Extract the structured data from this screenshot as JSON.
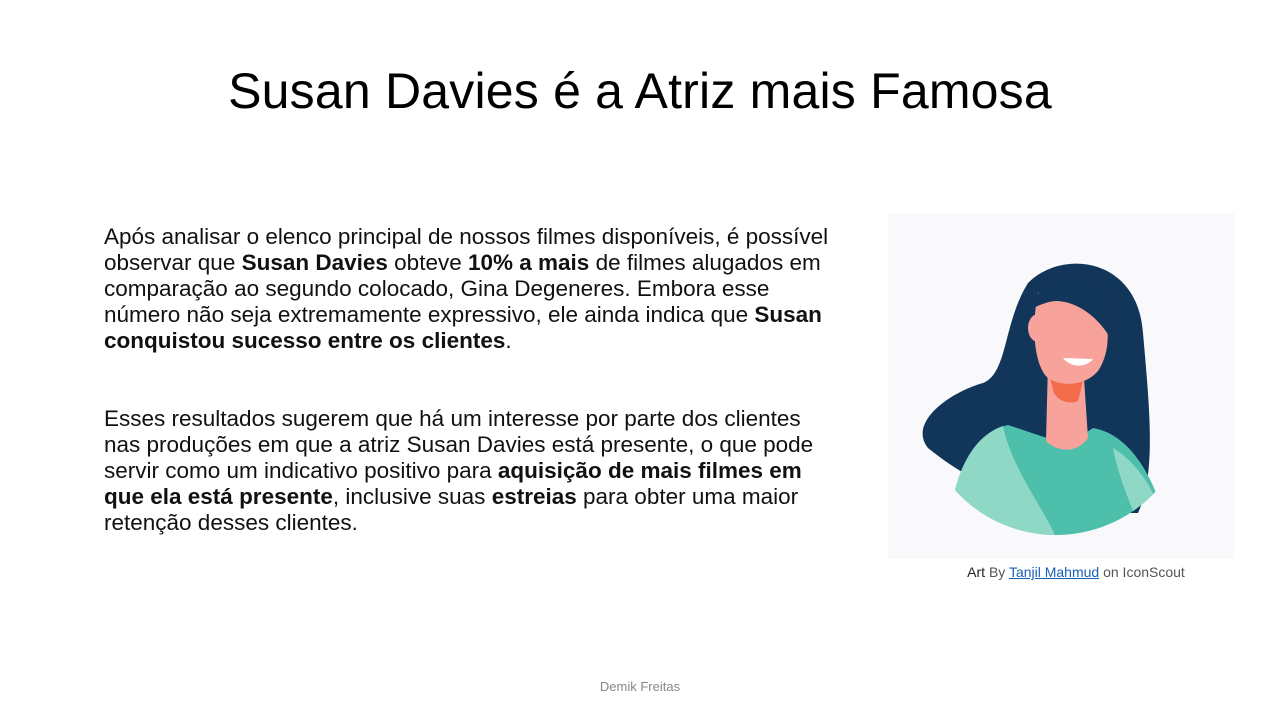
{
  "slide": {
    "title": "Susan Davies é a Atriz mais Famosa",
    "paragraph1": {
      "t1": "Após analisar o elenco principal de nossos filmes disponíveis, é possível observar que ",
      "b1": "Susan Davies",
      "t2": " obteve ",
      "b2": "10% a mais",
      "t3": " de filmes alugados em comparação ao segundo colocado, Gina Degeneres. Embora esse número não seja extremamente expressivo, ele ainda indica que ",
      "b3": "Susan conquistou sucesso entre os clientes",
      "t4": "."
    },
    "paragraph2": {
      "t1": "Esses resultados sugerem que há um interesse por parte dos clientes nas produções em que a atriz Susan Davies está presente, o que pode servir como um indicativo positivo para ",
      "b1": "aquisição de mais filmes em que ela está presente",
      "t2": ", inclusive suas ",
      "b2": "estreias",
      "t3": " para obter uma maior retenção desses clientes."
    },
    "credit": {
      "art": "Art",
      "by": " By ",
      "author": "Tanjil Mahmud",
      "source": " on IconScout"
    },
    "footer": "Demik Freitas"
  },
  "colors": {
    "hair": "#12355a",
    "skin": "#f7a39c",
    "shirt": "#4dbfaa",
    "shirt_light": "#8fd8c5",
    "collar": "#f26b4a"
  },
  "icons": {
    "illustration": "woman-avatar-illustration"
  }
}
